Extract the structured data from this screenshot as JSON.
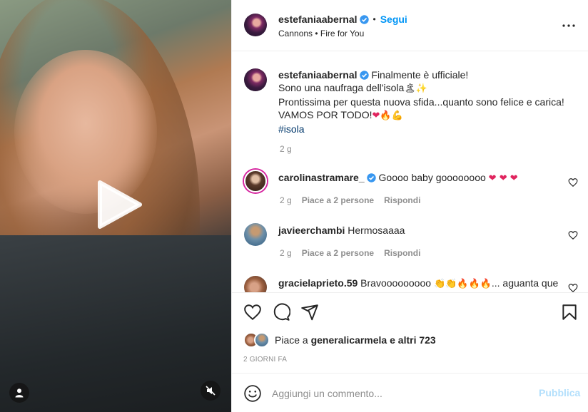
{
  "header": {
    "username": "estefaniaabernal",
    "separator": "•",
    "follow_label": "Segui",
    "subtitle": "Cannons • Fire for You"
  },
  "caption": {
    "username": "estefaniaabernal",
    "line1": "Finalmente è ufficiale!",
    "line2": "Sono una naufraga dell'isola",
    "line3": "Prontissima per questa nuova sfida...quanto sono felice e carica!",
    "line4": "VAMOS POR TODO!",
    "hashtag": "#isola",
    "time": "2 g"
  },
  "comments": [
    {
      "username": "carolinastramare_",
      "verified": true,
      "text": "Goooo baby goooooooo",
      "emoji": "❤ ❤ ❤",
      "time": "2 g",
      "likes": "Piace a 2 persone",
      "reply": "Rispondi"
    },
    {
      "username": "javieerchambi",
      "verified": false,
      "text": "Hermosaaaa",
      "emoji": "",
      "time": "2 g",
      "likes": "Piace a 2 persone",
      "reply": "Rispondi"
    },
    {
      "username": "gracielaprieto.59",
      "verified": false,
      "text": "Bravooooooooo",
      "emoji": "👏👏🔥🔥🔥",
      "tail": "... aguanta que"
    }
  ],
  "likes": {
    "prefix": "Piace a",
    "user": "generalicarmela",
    "suffix": "e altri 723"
  },
  "date": "2 GIORNI FA",
  "comment_box": {
    "placeholder": "Aggiungi un commento...",
    "publish_label": "Pubblica"
  },
  "colors": {
    "accent": "#0095f6",
    "publish_disabled": "#b2dffc",
    "verified": "#3897f0",
    "muted_text": "#8e8e8e"
  },
  "icons": [
    "play-icon",
    "user-tag-icon",
    "mute-icon",
    "more-icon",
    "verified-icon",
    "heart-icon",
    "comment-icon",
    "share-icon",
    "bookmark-icon",
    "emoji-icon"
  ]
}
